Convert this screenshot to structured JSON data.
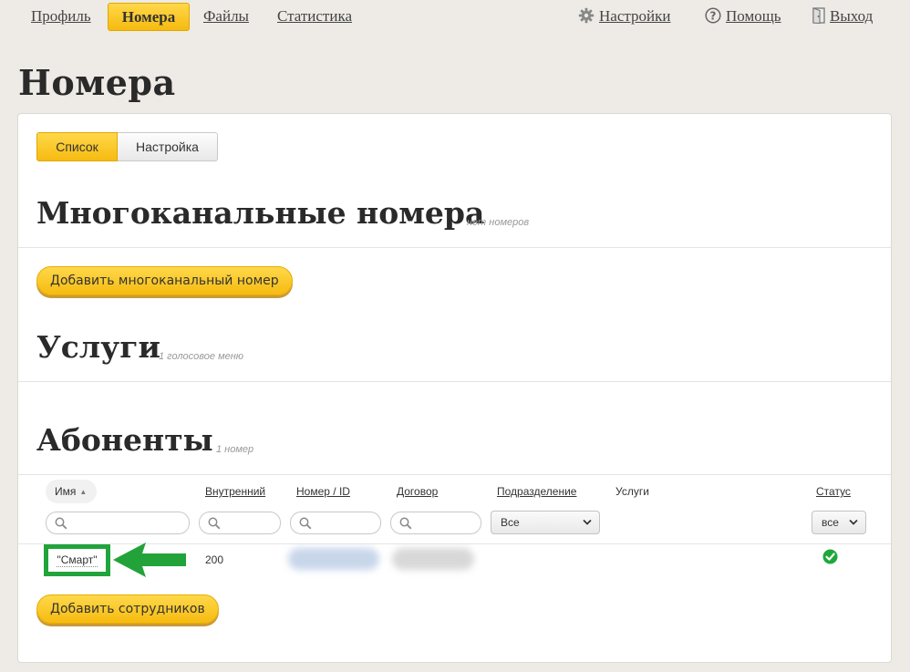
{
  "nav": {
    "profile": "Профиль",
    "numbers": "Номера",
    "files": "Файлы",
    "stats": "Статистика",
    "settings": "Настройки",
    "help": "Помощь",
    "logout": "Выход"
  },
  "page": {
    "title": "Номера"
  },
  "view_tabs": {
    "list": "Список",
    "setup": "Настройка"
  },
  "sections": {
    "multichannel": {
      "title": "Многоканальные номера",
      "note": "нет номеров",
      "add_button": "Добавить многоканальный номер"
    },
    "services": {
      "title": "Услуги",
      "note": "1 голосовое меню"
    },
    "subscribers": {
      "title": "Абоненты",
      "note": "1 номер",
      "add_button": "Добавить сотрудников"
    }
  },
  "table": {
    "columns": {
      "name": "Имя",
      "internal": "Внутренний",
      "number": "Номер / ID",
      "contract": "Договор",
      "department": "Подразделение",
      "services": "Услуги",
      "status": "Статус"
    },
    "filters": {
      "department": "Все",
      "status": "все"
    },
    "rows": [
      {
        "name": "\"Смарт\"",
        "internal": "200",
        "status": "ok"
      }
    ]
  },
  "icons": [
    "gear-icon",
    "help-circle-icon",
    "door-exit-icon",
    "search-icon",
    "chevron-down-icon",
    "check-circle-icon",
    "green-arrow-icon"
  ],
  "colors": {
    "accent": "#f6bb10",
    "highlight": "#21a43b",
    "status_ok": "#1ea83c"
  }
}
